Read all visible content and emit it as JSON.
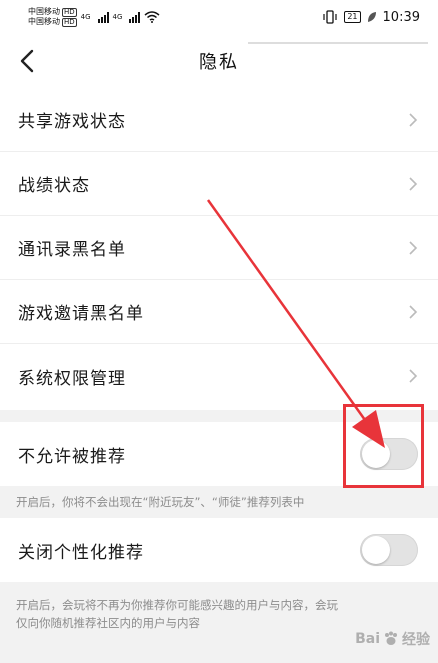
{
  "status_bar": {
    "carrier_1": "中国移动",
    "carrier_2": "中国移动",
    "hd_badge": "HD",
    "network_1": "4G",
    "network_2": "4G",
    "battery_level": "21",
    "time": "10:39"
  },
  "header": {
    "title": "隐私"
  },
  "menu": {
    "items": [
      {
        "label": "共享游戏状态"
      },
      {
        "label": "战绩状态"
      },
      {
        "label": "通讯录黑名单"
      },
      {
        "label": "游戏邀请黑名单"
      },
      {
        "label": "系统权限管理"
      }
    ]
  },
  "toggles": [
    {
      "label": "不允许被推荐",
      "enabled": false,
      "description": "开启后，你将不会出现在“附近玩友”、“师徒”推荐列表中"
    },
    {
      "label": "关闭个性化推荐",
      "enabled": false,
      "description_line1": "开启后，会玩将不再为你推荐你可能感兴趣的用户与内容，会玩",
      "description_line2": "仅向你随机推荐社区内的用户与内容"
    }
  ],
  "watermark": {
    "text_1": "Bai",
    "text_2": "经验"
  },
  "colors": {
    "annotation": "#e8343a",
    "toggle_off": "#e3e3e3",
    "section_gap": "#f2f2f2"
  }
}
